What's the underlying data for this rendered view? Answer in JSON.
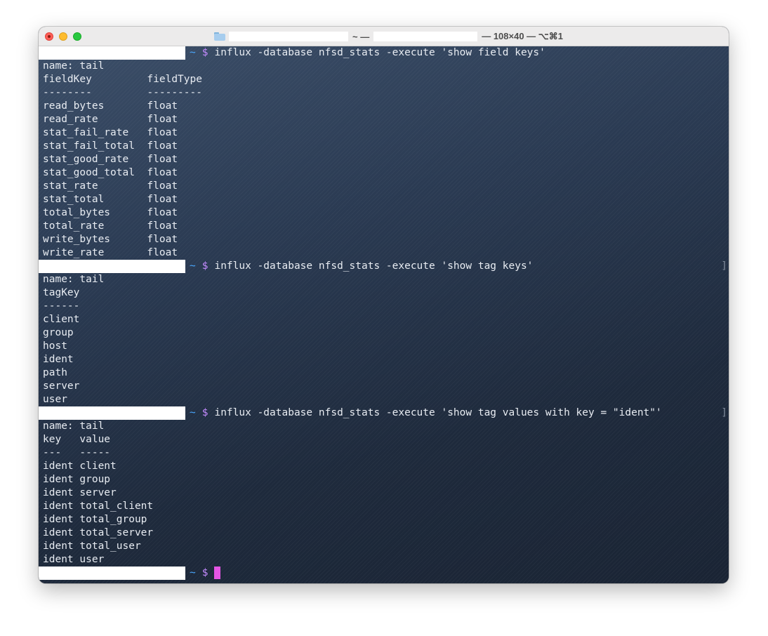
{
  "window": {
    "title_middle": "~ —",
    "title_size": "— 108×40 — ⌥⌘1"
  },
  "prompt": {
    "tilde": "~",
    "dollar": "$"
  },
  "block1": {
    "command": "influx -database nfsd_stats -execute 'show field keys'",
    "lines": [
      "name: tail",
      "fieldKey         fieldType",
      "--------         ---------",
      "read_bytes       float",
      "read_rate        float",
      "stat_fail_rate   float",
      "stat_fail_total  float",
      "stat_good_rate   float",
      "stat_good_total  float",
      "stat_rate        float",
      "stat_total       float",
      "total_bytes      float",
      "total_rate       float",
      "write_bytes      float",
      "write_rate       float"
    ]
  },
  "block2": {
    "command": "influx -database nfsd_stats -execute 'show tag keys'",
    "bracket": "]",
    "lines": [
      "name: tail",
      "tagKey",
      "------",
      "client",
      "group",
      "host",
      "ident",
      "path",
      "server",
      "user"
    ]
  },
  "block3": {
    "command": "influx -database nfsd_stats -execute 'show tag values with key = \"ident\"'",
    "bracket": "]",
    "lines": [
      "name: tail",
      "key   value",
      "---   -----",
      "ident client",
      "ident group",
      "ident server",
      "ident total_client",
      "ident total_group",
      "ident total_server",
      "ident total_user",
      "ident user"
    ]
  },
  "colors": {
    "tilde": "#4aa8ff",
    "dollar": "#c48bff",
    "cursor": "#e455e4",
    "text": "#e8ecf2"
  }
}
